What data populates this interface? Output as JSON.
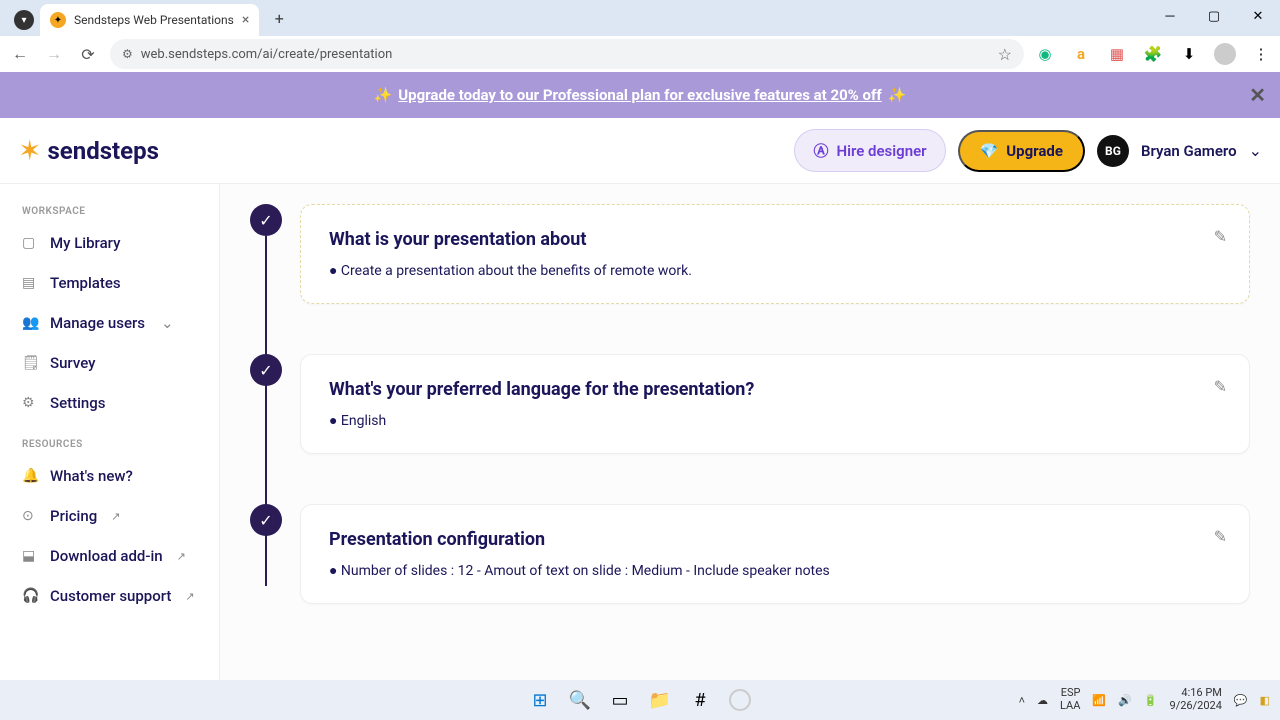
{
  "browser": {
    "tab_title": "Sendsteps Web Presentations",
    "url": "web.sendsteps.com/ai/create/presentation"
  },
  "promo": {
    "prefix": "✨ ",
    "text": "Upgrade today to our Professional plan for exclusive features at 20% off",
    "suffix": " ✨"
  },
  "header": {
    "logo_text": "sendsteps",
    "hire_label": "Hire designer",
    "upgrade_label": "Upgrade",
    "avatar_initials": "BG",
    "user_name": "Bryan Gamero"
  },
  "sidebar": {
    "workspace_label": "WORKSPACE",
    "resources_label": "RESOURCES",
    "workspace": [
      {
        "icon": "▢",
        "label": "My Library"
      },
      {
        "icon": "▤",
        "label": "Templates"
      },
      {
        "icon": "👥",
        "label": "Manage users",
        "expandable": true
      },
      {
        "icon": "🗒",
        "label": "Survey"
      },
      {
        "icon": "⚙",
        "label": "Settings"
      }
    ],
    "resources": [
      {
        "icon": "🔔",
        "label": "What's new?"
      },
      {
        "icon": "⊙",
        "label": "Pricing",
        "ext": true
      },
      {
        "icon": "⬓",
        "label": "Download add-in",
        "ext": true
      },
      {
        "icon": "🎧",
        "label": "Customer support",
        "ext": true
      }
    ]
  },
  "steps": [
    {
      "title": "What is your presentation about",
      "body": "● Create a presentation about the benefits of remote work."
    },
    {
      "title": "What's your preferred language for the presentation?",
      "body": "● English"
    },
    {
      "title": "Presentation configuration",
      "body": "● Number of slides : 12 - Amout of text on slide : Medium - Include speaker notes"
    }
  ],
  "taskbar": {
    "lang": "ESP",
    "loc": "LAA",
    "time": "4:16 PM",
    "date": "9/26/2024"
  }
}
